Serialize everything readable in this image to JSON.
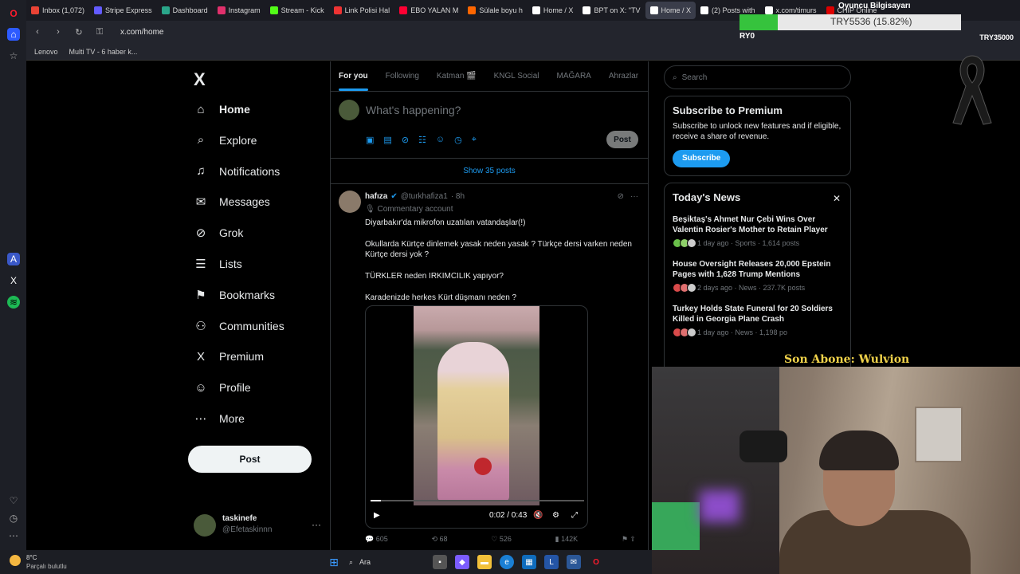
{
  "browser": {
    "tabs": [
      {
        "label": "Inbox (1,072)",
        "color": "#ea4335"
      },
      {
        "label": "Stripe Express",
        "color": "#635bff"
      },
      {
        "label": "Dashboard",
        "color": "#2aa68a"
      },
      {
        "label": "Instagram",
        "color": "#e1306c"
      },
      {
        "label": "Stream - Kick",
        "color": "#53fc18"
      },
      {
        "label": "Link Polisi Hal",
        "color": "#e33"
      },
      {
        "label": "EBO YALAN M",
        "color": "#f03"
      },
      {
        "label": "Sülale boyu h",
        "color": "#f60"
      },
      {
        "label": "Home / X",
        "color": "#fff"
      },
      {
        "label": "BPT on X: \"TV",
        "color": "#fff"
      },
      {
        "label": "Home / X",
        "color": "#fff"
      },
      {
        "label": "(2) Posts with",
        "color": "#fff"
      },
      {
        "label": "x.com/timurs",
        "color": "#fff"
      },
      {
        "label": "CHIP Online",
        "color": "#d00"
      }
    ],
    "url": "x.com/home",
    "bookmarks": [
      "Lenovo",
      "Multi TV - 6 haber k..."
    ]
  },
  "nav": {
    "items": [
      {
        "label": "Home",
        "icon": "home-icon",
        "glyph": "⌂"
      },
      {
        "label": "Explore",
        "icon": "search-icon",
        "glyph": "⌕"
      },
      {
        "label": "Notifications",
        "icon": "bell-icon",
        "glyph": "♫"
      },
      {
        "label": "Messages",
        "icon": "mail-icon",
        "glyph": "✉"
      },
      {
        "label": "Grok",
        "icon": "grok-icon",
        "glyph": "⊘"
      },
      {
        "label": "Lists",
        "icon": "list-icon",
        "glyph": "☰"
      },
      {
        "label": "Bookmarks",
        "icon": "bookmark-icon",
        "glyph": "⚑"
      },
      {
        "label": "Communities",
        "icon": "people-icon",
        "glyph": "⚇"
      },
      {
        "label": "Premium",
        "icon": "x-icon",
        "glyph": "X"
      },
      {
        "label": "Profile",
        "icon": "person-icon",
        "glyph": "☺"
      },
      {
        "label": "More",
        "icon": "more-icon",
        "glyph": "⋯"
      }
    ],
    "post_label": "Post",
    "user_name": "taskinefe",
    "user_handle": "@Efetaskinnn"
  },
  "feed": {
    "tabs": [
      "For you",
      "Following",
      "Katman 🎬",
      "KNGL Social",
      "MAĞARA",
      "Ahrazlar"
    ],
    "compose_placeholder": "What's happening?",
    "compose_post": "Post",
    "show_posts": "Show 35 posts",
    "post": {
      "name": "hafıza",
      "handle": "@turkhafiza1",
      "time": "· 8h",
      "label": "Commentary account",
      "lines": [
        "Diyarbakır'da mikrofon uzatılan vatandaşlar(!)",
        "Okullarda Kürtçe dinlemek yasak neden yasak ? Türkçe dersi varken neden",
        "Kürtçe dersi yok ?",
        "TÜRKLER neden IRKIMCILIK yapıyor?",
        "Karadenizde herkes Kürt düşmanı neden ?"
      ],
      "video_time": "0:02 / 0:43",
      "video_progress": 0.05,
      "stats": {
        "replies": "605",
        "reposts": "68",
        "likes": "526",
        "views": "142K"
      }
    }
  },
  "right": {
    "search_placeholder": "Search",
    "premium_title": "Subscribe to Premium",
    "premium_text": "Subscribe to unlock new features and if eligible, receive a share of revenue.",
    "premium_button": "Subscribe",
    "news_title": "Today's News",
    "news": [
      {
        "title": "Beşiktaş's Ahmet Nur Çebi Wins Over Valentin Rosier's Mother to Retain Player",
        "meta": "1 day ago · Sports · 1,614 posts"
      },
      {
        "title": "House Oversight Releases 20,000 Epstein Pages with 1,628 Trump Mentions",
        "meta": "2 days ago · News · 237.7K posts"
      },
      {
        "title": "Turkey Holds State Funeral for 20 Soldiers Killed in Georgia Plane Crash",
        "meta": "1 day ago · News · 1,198 po"
      }
    ]
  },
  "overlay": {
    "goal_title": "Oyuncu Bilgisayarı",
    "goal_amount": "TRY5536 (15.82%)",
    "goal_left": "RY0",
    "goal_right": "TRY35000",
    "goal_progress": 0.1582,
    "son_abone": "Son Abone: Wulvion"
  },
  "taskbar": {
    "temp": "8°C",
    "condition": "Parçalı bulutlu",
    "search": "Ara"
  },
  "colors": {
    "accent": "#1d9bf0",
    "bg": "#000000",
    "border": "#2f3336",
    "muted": "#71767b"
  }
}
